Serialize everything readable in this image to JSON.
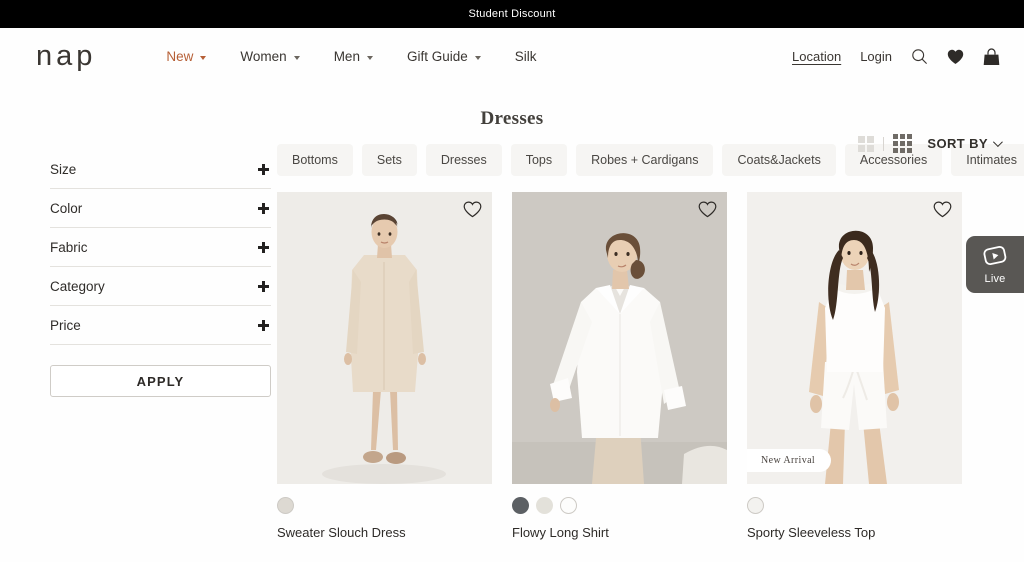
{
  "announcement": {
    "text": "Student Discount"
  },
  "header": {
    "logo": "nap",
    "nav": [
      {
        "label": "New",
        "has_caret": true,
        "accent_color": "#b65f36"
      },
      {
        "label": "Women",
        "has_caret": true
      },
      {
        "label": "Men",
        "has_caret": true
      },
      {
        "label": "Gift Guide",
        "has_caret": true
      },
      {
        "label": "Silk",
        "has_caret": false
      }
    ],
    "right": {
      "location": "Location",
      "login": "Login",
      "search_icon": "search-icon",
      "wishlist_icon": "heart-icon",
      "cart_icon": "shopping-bag-icon"
    }
  },
  "page_title": "Dresses",
  "toolbar": {
    "grid_two_icon": "grid-2-column-icon",
    "grid_three_icon": "grid-3-column-icon",
    "active_view": "grid-3-column-icon",
    "sort_label": "SORT BY",
    "sort_chevron": "chevron-down-icon"
  },
  "sidebar": {
    "filters": [
      {
        "label": "Size",
        "toggle": "+"
      },
      {
        "label": "Color",
        "toggle": "+"
      },
      {
        "label": "Fabric",
        "toggle": "+"
      },
      {
        "label": "Category",
        "toggle": "+"
      },
      {
        "label": "Price",
        "toggle": "+"
      }
    ],
    "apply_label": "APPLY"
  },
  "categories": [
    {
      "label": "Bottoms"
    },
    {
      "label": "Sets"
    },
    {
      "label": "Dresses"
    },
    {
      "label": "Tops"
    },
    {
      "label": "Robes + Cardigans"
    },
    {
      "label": "Coats&Jackets"
    },
    {
      "label": "Accessories"
    },
    {
      "label": "Intimates"
    }
  ],
  "products": [
    {
      "name": "Sweater Slouch Dress",
      "badge": null,
      "favorite_icon": "heart-outline-icon",
      "bg": "#eeece8",
      "garment": "#e6d8c6",
      "swatches": [
        {
          "color": "#ddd9d2",
          "selected": true
        }
      ]
    },
    {
      "name": "Flowy Long Shirt",
      "badge": null,
      "favorite_icon": "heart-outline-icon",
      "bg": "#cdc9c3",
      "garment": "#fbfaf8",
      "swatches": [
        {
          "color": "#5c6064",
          "selected": false
        },
        {
          "color": "#e3e1da",
          "selected": false
        },
        {
          "color": "#fdfdfc",
          "selected": true
        }
      ]
    },
    {
      "name": "Sporty Sleeveless Top",
      "badge": "New Arrival",
      "favorite_icon": "heart-outline-icon",
      "bg": "#f2f0ed",
      "garment": "#fdfcfb",
      "swatches": [
        {
          "color": "#f3f2ef",
          "selected": true
        }
      ]
    }
  ],
  "live_widget": {
    "label": "Live",
    "icon": "video-play-icon"
  }
}
